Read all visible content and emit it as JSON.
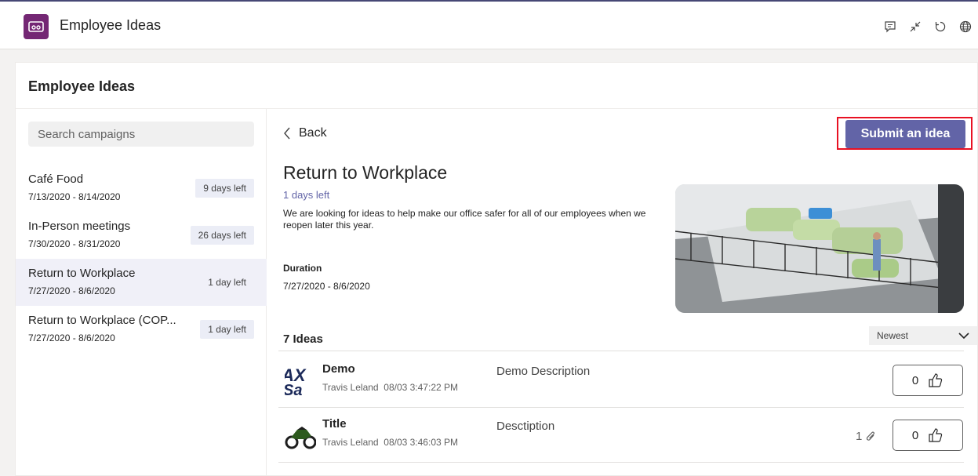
{
  "app": {
    "title": "Employee Ideas",
    "icon": "app-logo-icon",
    "accent": "#6264a7",
    "brand_color": "#742774"
  },
  "toolbar": {
    "icons": [
      "feedback-icon",
      "collapse-icon",
      "refresh-icon",
      "globe-icon"
    ]
  },
  "page": {
    "title": "Employee Ideas"
  },
  "sidebar": {
    "search_placeholder": "Search campaigns",
    "campaigns": [
      {
        "name": "Café Food",
        "dates": "7/13/2020 - 8/14/2020",
        "badge": "9 days left",
        "selected": false
      },
      {
        "name": "In-Person meetings",
        "dates": "7/30/2020 - 8/31/2020",
        "badge": "26 days left",
        "selected": false
      },
      {
        "name": "Return to Workplace",
        "dates": "7/27/2020 - 8/6/2020",
        "badge": "1 day left",
        "selected": true
      },
      {
        "name": "Return to Workplace (COP...",
        "dates": "7/27/2020 - 8/6/2020",
        "badge": "1 day left",
        "selected": false
      }
    ]
  },
  "detail": {
    "back_label": "Back",
    "submit_label": "Submit an idea",
    "title": "Return to Workplace",
    "days_left": "1 days left",
    "description": "We are looking for ideas to help make our office safer for all of our employees when we reopen later this year.",
    "duration_label": "Duration",
    "duration_value": "7/27/2020 - 8/6/2020"
  },
  "ideas": {
    "count_label": "7 Ideas",
    "sort_selected": "Newest",
    "items": [
      {
        "title": "Demo",
        "author": "Travis Leland",
        "timestamp": "08/03 3:47:22 PM",
        "description": "Demo Description",
        "attachments": "",
        "likes": "0",
        "thumb": "brand-logo-thumb"
      },
      {
        "title": "Title",
        "author": "Travis Leland",
        "timestamp": "08/03 3:46:03 PM",
        "description": "Desctiption",
        "attachments": "1",
        "likes": "0",
        "thumb": "motorcycle-thumb"
      }
    ]
  }
}
